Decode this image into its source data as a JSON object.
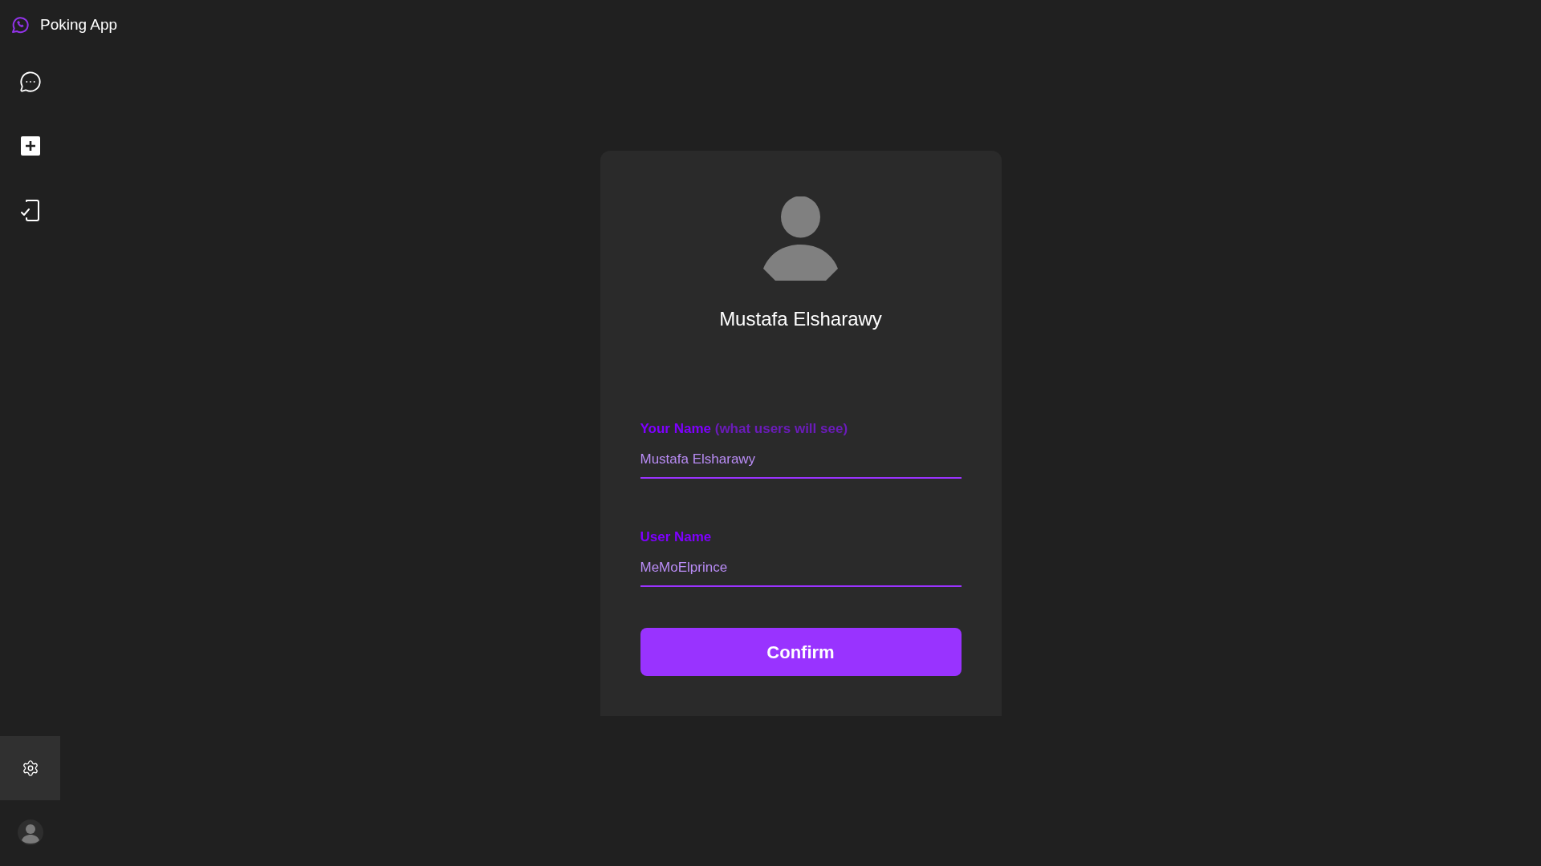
{
  "app": {
    "title": "Poking App"
  },
  "sidebar": {
    "top_items": [
      {
        "kind": "chats",
        "selected": false
      },
      {
        "kind": "add",
        "selected": false
      },
      {
        "kind": "status",
        "selected": false
      }
    ],
    "bottom_items": [
      {
        "kind": "settings",
        "selected": true
      },
      {
        "kind": "profile",
        "selected": false
      }
    ]
  },
  "profile_card": {
    "display_name": "Mustafa Elsharawy",
    "fields": [
      {
        "label": "Your Name",
        "note": "(what users will see)",
        "value": "Mustafa Elsharawy"
      },
      {
        "label": "User Name",
        "value": "MeMoElprince"
      }
    ],
    "button": "Confirm"
  }
}
